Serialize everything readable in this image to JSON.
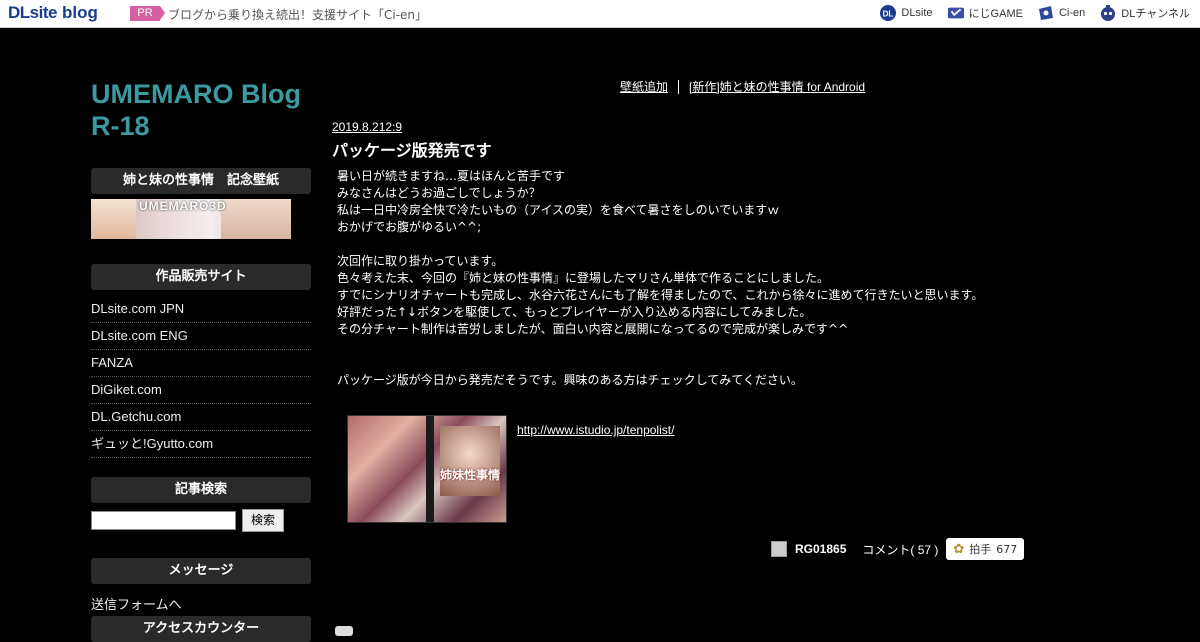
{
  "topbar": {
    "logo_dl": "DLsite",
    "logo_blog": "blog",
    "pr_badge": "PR",
    "pr_text": "ブログから乗り換え続出！支援サイト「Ci-en」",
    "links": [
      {
        "label": "DLsite",
        "icon": "dlsite-icon"
      },
      {
        "label": "にじGAME",
        "icon": "nijigame-icon"
      },
      {
        "label": "Ci-en",
        "icon": "cien-icon"
      },
      {
        "label": "DLチャンネル",
        "icon": "dlchannel-icon"
      }
    ]
  },
  "sidebar": {
    "blog_title": "UMEMARO Blog R-18",
    "wallpaper_heading": "姉と妹の性事情　記念壁紙",
    "banner_text": "UMEMARO3D",
    "sites_heading": "作品販売サイト",
    "sites": [
      "DLsite.com JPN",
      "DLsite.com ENG",
      "FANZA",
      "DiGiket.com",
      "DL.Getchu.com",
      "ギュッと!Gyutto.com"
    ],
    "search_heading": "記事検索",
    "search_button": "検索",
    "search_value": "",
    "message_heading": "メッセージ",
    "message_link": "送信フォームへ",
    "counter_heading": "アクセスカウンター"
  },
  "main": {
    "nav_links": [
      "壁紙追加",
      "[新作]姉と妹の性事情 for Android"
    ],
    "post": {
      "date": "2019.8.212:9",
      "title": "パッケージ版発売です",
      "body_lines": [
        "暑い日が続きますね…夏はほんと苦手です",
        "みなさんはどうお過ごしでしょうか？",
        "私は一日中冷房全快で冷たいもの（アイスの実）を食べて暑さをしのいでいますｗ",
        "おかげでお腹がゆるい^^;",
        "",
        "次回作に取り掛かっています。",
        "色々考えた末、今回の『姉と妹の性事情』に登場したマリさん単体で作ることにしました。",
        "すでにシナリオチャートも完成し、水谷六花さんにも了解を得ましたので、これから徐々に進めて行きたいと思います。",
        "好評だった↑↓ボタンを駆使して、もっとプレイヤーが入り込める内容にしてみました。",
        "その分チャート制作は苦労しましたが、面白い内容と展開になってるので完成が楽しみです^^",
        "",
        "",
        "パッケージ版が今日から発売だそうです。興味のある方はチェックしてみてください。"
      ],
      "package_title": "姉妹性事情",
      "link": "http://www.istudio.jp/tenpolist/",
      "author": "RG01865",
      "comments": "コメント( 57 )",
      "clap_label": "拍手",
      "clap_count": "677"
    }
  },
  "colors": {
    "background": "#000000",
    "title": "#3b9aa0",
    "sidebar_heading": "#2a2a2a",
    "pr_badge": "#d45fa3"
  }
}
